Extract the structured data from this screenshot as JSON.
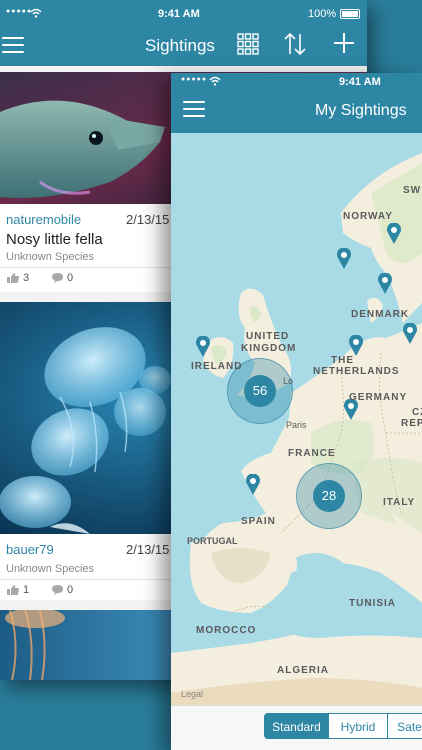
{
  "back_screen": {
    "status": {
      "signal": "●●●●●",
      "time": "9:41 AM",
      "battery": "100%"
    },
    "nav": {
      "title": "Sightings"
    },
    "cards": [
      {
        "user": "naturemobile",
        "date": "2/13/15",
        "title": "Nosy little fella",
        "species": "Unknown Species",
        "likes": "3",
        "comments": "0"
      },
      {
        "user": "bauer79",
        "date": "2/13/15",
        "title": "",
        "species": "Unknown Species",
        "likes": "1",
        "comments": "0"
      }
    ]
  },
  "front_screen": {
    "status": {
      "signal": "●●●●●",
      "time": "9:41 AM"
    },
    "nav": {
      "title": "My Sightings"
    },
    "map": {
      "labels": {
        "norway": "NORWAY",
        "sweden": "SW",
        "denmark": "DENMARK",
        "uk": "UNITED",
        "uk2": "KINGDOM",
        "ireland": "IRELAND",
        "netherlands": "THE",
        "netherlands2": "NETHERLANDS",
        "germany": "GERMANY",
        "czech": "CZ",
        "czech2": "REP",
        "london": "Lo",
        "paris": "Paris",
        "france": "FRANCE",
        "spain": "SPAIN",
        "portugal": "PORTUGAL",
        "italy": "ITALY",
        "tunisia": "TUNISIA",
        "morocco": "MOROCCO",
        "algeria": "ALGERIA",
        "legal": "Legal"
      },
      "clusters": [
        {
          "count": "56"
        },
        {
          "count": "28"
        }
      ]
    },
    "map_types": [
      "Standard",
      "Hybrid",
      "Sate"
    ],
    "selected_map_type": "Standard"
  },
  "colors": {
    "brand": "#2e86a5",
    "map_water": "#a8dbe6",
    "map_land": "#f4eedf",
    "map_green": "#d9e8c6"
  }
}
